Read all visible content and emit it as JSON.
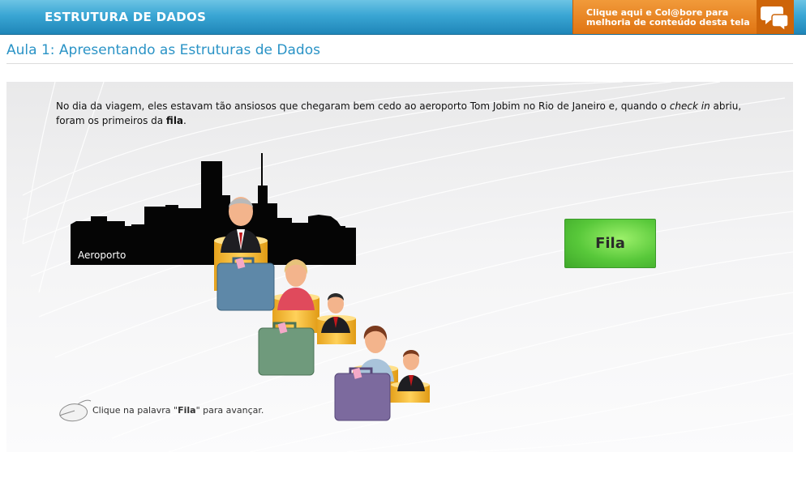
{
  "header": {
    "course_title": "ESTRUTURA DE DADOS",
    "collab_line1": "Clique aqui e Col@bore para",
    "collab_line2": "melhoria de conteúdo desta tela",
    "collab_icon": "speech-bubbles-icon"
  },
  "lesson": {
    "title": "Aula 1: Apresentando as Estruturas de Dados"
  },
  "narration": {
    "part1": "No dia da viagem, eles estavam tão ansiosos que chegaram bem cedo ao aeroporto Tom Jobim no Rio de Janeiro e, quando o ",
    "emphasis": "check in",
    "part2": " abriu, foram os primeiros da ",
    "bold": "fila",
    "part3": "."
  },
  "scene": {
    "skyline_label": "Aeroporto",
    "people": [
      "elderly-man",
      "woman-blonde",
      "boy",
      "woman-brunette",
      "boy"
    ],
    "suitcase_colors": [
      "#5e88a8",
      "#6f9a7c",
      "#7c6a9e"
    ]
  },
  "fila_button": {
    "label": "Fila",
    "color": "#58c83a"
  },
  "hint": {
    "icon": "mouse-icon",
    "prefix": "Clique na palavra \"",
    "keyword": "Fila",
    "suffix": "\" para avançar."
  }
}
